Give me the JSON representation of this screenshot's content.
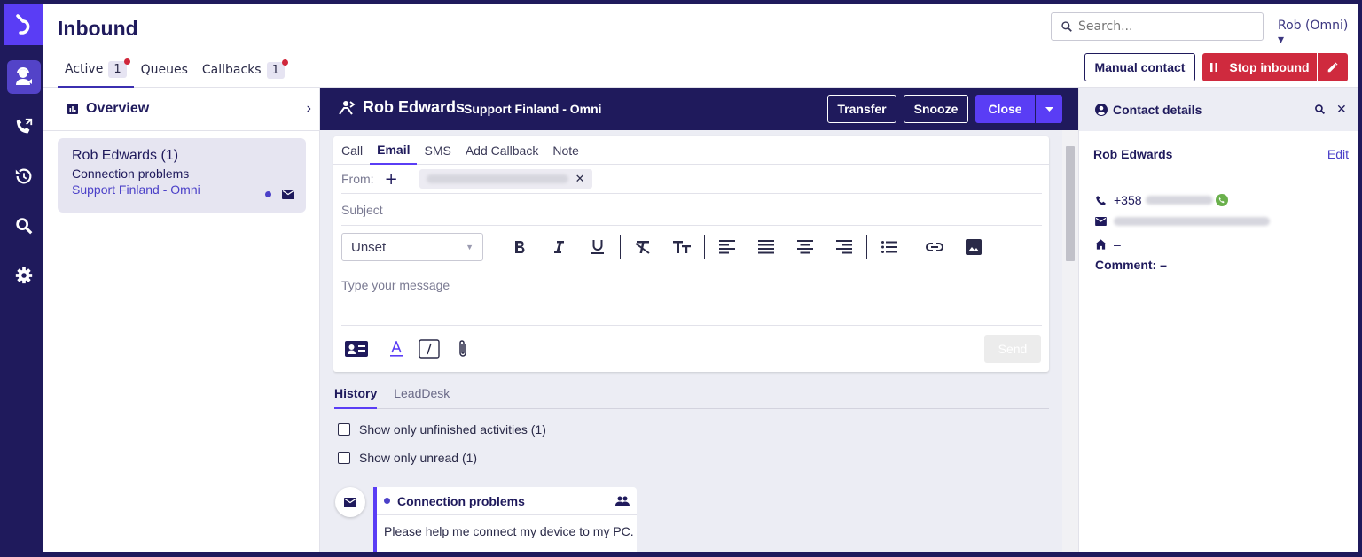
{
  "app": {
    "title": "Inbound"
  },
  "tabs": [
    {
      "label": "Active",
      "count": "1"
    },
    {
      "label": "Queues"
    },
    {
      "label": "Callbacks",
      "count": "1"
    }
  ],
  "search": {
    "placeholder": "Search..."
  },
  "user": {
    "label": "Rob (Omni)"
  },
  "header_buttons": {
    "manual": "Manual contact",
    "stop": "Stop inbound"
  },
  "sidebar": {
    "overview": "Overview"
  },
  "conversation_card": {
    "name": "Rob Edwards (1)",
    "subject": "Connection problems",
    "queue": "Support Finland - Omni"
  },
  "conversation": {
    "name": "Rob Edwards",
    "queue": "Support Finland - Omni",
    "transfer": "Transfer",
    "snooze": "Snooze",
    "close": "Close"
  },
  "composer": {
    "tabs": [
      "Call",
      "Email",
      "SMS",
      "Add Callback",
      "Note"
    ],
    "active_tab": "Email",
    "from_label": "From:",
    "subject_placeholder": "Subject",
    "format_select": "Unset",
    "message_placeholder": "Type your message",
    "send": "Send"
  },
  "history": {
    "tabs": [
      "History",
      "LeadDesk"
    ],
    "filters": [
      "Show only unfinished activities (1)",
      "Show only unread (1)"
    ],
    "activity": {
      "title": "Connection problems",
      "body": "Please help me connect my device to my PC."
    }
  },
  "contact": {
    "header": "Contact details",
    "name": "Rob Edwards",
    "edit": "Edit",
    "phone_prefix": "+358",
    "address": "–",
    "comment": "Comment: –"
  },
  "colors": {
    "brand": "#1f1a5c",
    "accent": "#5a3df5",
    "danger": "#cf2a3e"
  }
}
